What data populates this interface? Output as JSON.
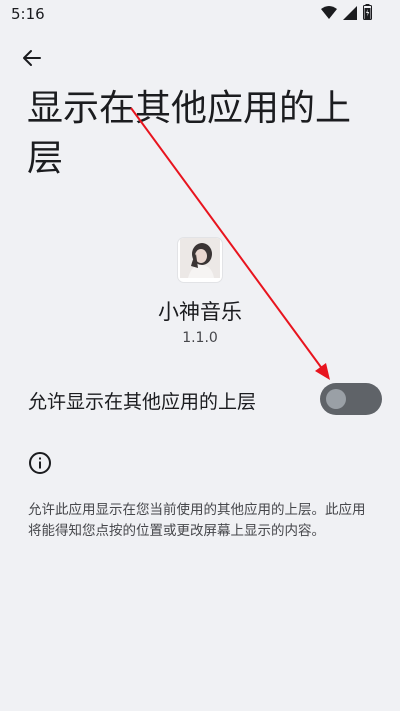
{
  "status_bar": {
    "time": "5:16",
    "icons": [
      "wifi-icon",
      "signal-icon",
      "battery-icon"
    ]
  },
  "header": {
    "back_icon": "arrow-back-icon",
    "title": "显示在其他应用的上层"
  },
  "app": {
    "icon": "app-avatar-icon",
    "name": "小神音乐",
    "version": "1.1.0"
  },
  "permission": {
    "label": "允许显示在其他应用的上层",
    "enabled": false
  },
  "info": {
    "icon": "info-icon",
    "text": "允许此应用显示在您当前使用的其他应用的上层。此应用将能得知您点按的位置或更改屏幕上显示的内容。"
  },
  "colors": {
    "background": "#f0f1f4",
    "switch_track_off": "#5f6368",
    "switch_thumb_off": "#9aa0a6",
    "annotation_arrow": "#e8141e"
  }
}
